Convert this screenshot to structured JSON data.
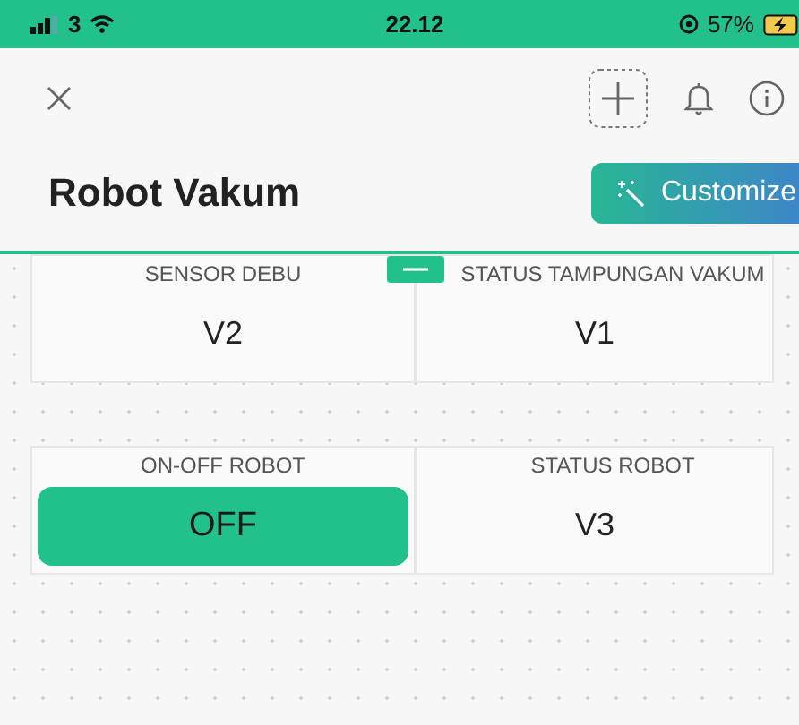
{
  "status_bar": {
    "carrier": "3",
    "time": "22.12",
    "battery": "57%"
  },
  "header": {
    "title": "Robot Vakum",
    "customize_button": "Customize"
  },
  "widget_rows": [
    {
      "widgets": [
        {
          "kind": "label",
          "title": "SENSOR DEBU",
          "value": "V2"
        },
        {
          "kind": "label",
          "title": "STATUS TAMPUNGAN VAKUM",
          "value": "V1"
        }
      ]
    },
    {
      "widgets": [
        {
          "kind": "button",
          "title": "ON-OFF ROBOT",
          "value": "OFF"
        },
        {
          "kind": "label",
          "title": "STATUS ROBOT",
          "value": "V3"
        }
      ]
    }
  ]
}
